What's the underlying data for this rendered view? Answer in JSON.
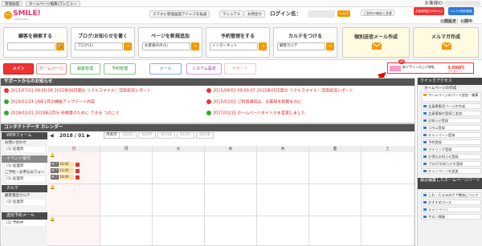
{
  "topbar": {
    "tabs": [
      "管理画面",
      "ホームページ編集/プレビュー"
    ],
    "shop_label": "お客様ID"
  },
  "header": {
    "logo_text": "SMILE!",
    "logo_sub": "smile skin",
    "buttons": [
      "スマホに管理画面アドレスを転送",
      "マニュアル",
      "お問合せ"
    ],
    "login_label": "ログイン名：",
    "help": "ヘルプ",
    "badge_change": "ご契約の確認と変更",
    "badge_point": "お客様限定20000ん2",
    "badge_mail": "メルマガ無料配信",
    "public_setting": "公開設定：公開中"
  },
  "feature_boxes": [
    {
      "title": "顧客を検索する",
      "select": "",
      "go": "🔍"
    },
    {
      "title": "ブログ/お知らせを書く",
      "select": "ブログ(1)",
      "go": "→"
    },
    {
      "title": "ページを新規追加",
      "select": "お客様の声(1)",
      "go": "→"
    },
    {
      "title": "予約管理をする",
      "select": "インターネット",
      "go": "→"
    },
    {
      "title": "カルテをつける",
      "select": "顧客カルテ",
      "go": "→"
    },
    {
      "title": "個別送信メール作成",
      "select": "",
      "go": ""
    },
    {
      "title": "メルマガ作成",
      "select": "",
      "go": ""
    }
  ],
  "nav": [
    "メイン",
    "ホームページ",
    "顧客管理",
    "予約管理",
    "メール",
    "システム設定",
    "サポート"
  ],
  "promo": {
    "text": "新デザイン仕上げ移転",
    "badge": "20",
    "price": "3,000円",
    "gift": "プレゼント"
  },
  "news": {
    "title": "サポートからのお知らせ",
    "items": [
      "2015/07/01 09:00:08 2015年06月度の リクルスマイル！活用状況レポート",
      "2015/06/01 09:00:07 2015年05月度の リクルスマイル！活用状況レポート",
      "2018/01/24 18年1月の機能アップデート内容",
      "2015/01/02 ご利用通知は、お客様を拒絶をのに",
      "2018/02/01 2018年2月分 非規事のために できる つのこと",
      "2017/03/15 ホームページタイトルを変更しました"
    ]
  },
  "calendar": {
    "title": "コンタクトデータ カレンダー",
    "year_month": "2018 / 01",
    "view_btn": "月表示",
    "dates": [
      "12/31",
      "01/07",
      "01/14",
      "01/21",
      "01/28"
    ],
    "days": [
      "日",
      "月",
      "火",
      "水",
      "木",
      "金",
      "土"
    ],
    "events": [
      {
        "tag": "終了",
        "time": "10:00"
      },
      {
        "tag": "終了",
        "time": "13:00"
      },
      {
        "tag": "終了",
        "time": "16:00"
      }
    ]
  },
  "leftnav": {
    "sections": [
      {
        "head": "WEBフォーム",
        "items": [
          "お問い合わせ",
          "(1) 処理済"
        ]
      },
      {
        "head": "イベント受付",
        "items": [
          "(1) 処理済",
          "ご予約・お申込みフォーム",
          "(1) 処理済"
        ]
      },
      {
        "head": "カルテ",
        "items": [
          "顧客電話カルテ",
          "(1) 処理済"
        ]
      },
      {
        "head": "送信予約メール",
        "items": [
          "(1) 予約中"
        ]
      }
    ]
  },
  "quick": {
    "title": "クイックアクセス",
    "sub": "ホームページの作成",
    "items": [
      "ホームページのパーツ追加・編集",
      "会員募集用ページの作成",
      "会員情報の登録と追加",
      "お知らせ登録",
      "コラム登録",
      "キャンペーン登録",
      "予約登録",
      "マイリング登録",
      "お得なお知らせ登録",
      "ブログ/お知らせを登録",
      "キャンペーンを追加"
    ],
    "recent_title": "最近編集したホームページパーツ",
    "recent": [
      "しわ・たるみのケア整体について",
      "おすすめコース",
      "キャンペーン",
      "サロン情報"
    ]
  }
}
